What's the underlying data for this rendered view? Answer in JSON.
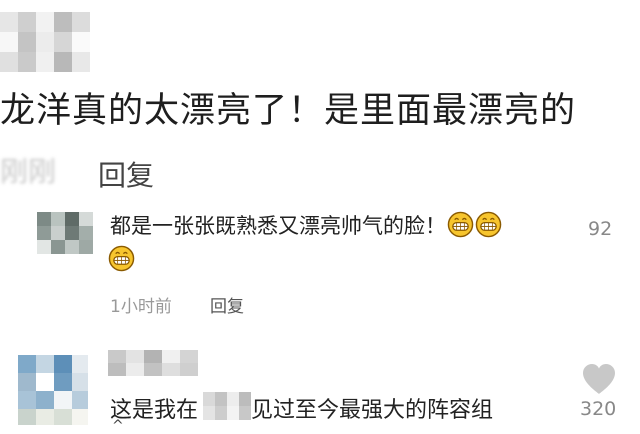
{
  "comment_1": {
    "text": "龙洋真的太漂亮了！是里面最漂亮的",
    "time_partial": "刚刚",
    "reply_label": "回复"
  },
  "reply_1": {
    "text": "都是一张张既熟悉又漂亮帅气的脸！",
    "emoji": "grinning-face-icon",
    "likes": "92",
    "time": "1小时前",
    "reply_label": "回复"
  },
  "comment_2": {
    "text_before": "这是我在",
    "text_after": "见过至今最强大的阵容组",
    "likes": "320",
    "expand_glyph": "^"
  },
  "colors": {
    "like_icon": "#c8c8c8",
    "muted_text": "#999999",
    "emoji_face": "#f7c52d"
  }
}
